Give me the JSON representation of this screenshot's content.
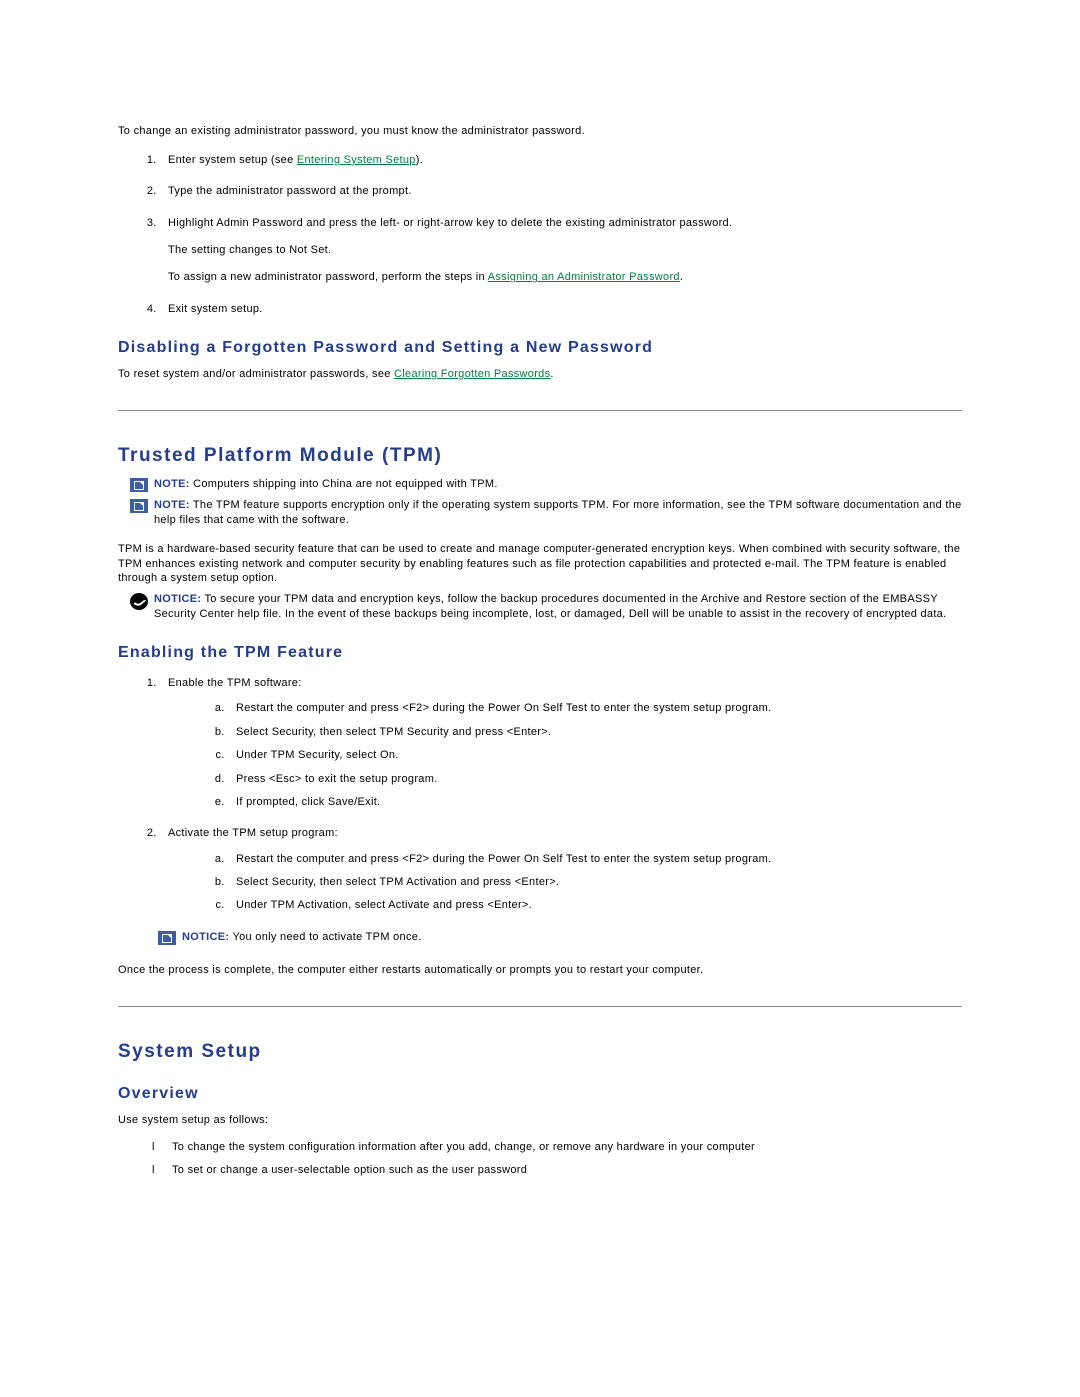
{
  "intro": "To change an existing administrator password, you must know the administrator password.",
  "adminSteps": {
    "s1a": "Enter system setup (see ",
    "s1link": "Entering System Setup",
    "s1b": ").",
    "s2": "Type the administrator password at the prompt.",
    "s3a": "Highlight Admin Password and press the left- or right-arrow key to delete the existing administrator password.",
    "s3b": "The setting changes to Not Set.",
    "s3c": "To assign a new administrator password, perform the steps in ",
    "s3link": "Assigning an Administrator Password",
    "s3d": ".",
    "s4": "Exit system setup."
  },
  "disable": {
    "heading": "Disabling a Forgotten Password and Setting a New Password",
    "textA": "To reset system and/or administrator passwords, see ",
    "link": "Clearing Forgotten Passwords",
    "textB": "."
  },
  "tpm": {
    "heading": "Trusted Platform Module (TPM)",
    "note1": " Computers shipping into China are not equipped with TPM.",
    "note2": " The TPM feature supports encryption only if the operating system supports TPM. For more information, see the TPM software documentation and the help files that came with the software.",
    "desc": "TPM is a hardware-based security feature that can be used to create and manage computer-generated encryption keys. When combined with security software, the TPM enhances existing network and computer security by enabling features such as file protection capabilities and protected e-mail. The TPM feature is enabled through a system setup option.",
    "notice": " To secure your TPM data and encryption keys, follow the backup procedures documented in the Archive and Restore section of the EMBASSY Security Center help file. In the event of these backups being incomplete, lost, or damaged, Dell will be unable to assist in the recovery of encrypted data.",
    "enableHeading": "Enabling the TPM Feature",
    "ol1": {
      "main": "Enable the TPM software:",
      "a": "Restart the computer and press <F2> during the Power On Self Test to enter the system setup program.",
      "b": "Select Security, then select TPM Security and press <Enter>.",
      "c": "Under TPM Security, select On.",
      "d": "Press <Esc> to exit the setup program.",
      "e": "If prompted, click Save/Exit."
    },
    "ol2": {
      "main": "Activate the TPM setup program:",
      "a": "Restart the computer and press <F2> during the Power On Self Test to enter the system setup program.",
      "b": "Select Security, then select TPM Activation and press <Enter>.",
      "c": "Under TPM Activation, select Activate and press <Enter>."
    },
    "notice2": " You only need to activate TPM once.",
    "after": "Once the process is complete, the computer either restarts automatically or prompts you to restart your computer."
  },
  "labels": {
    "note": "NOTE:",
    "notice": "NOTICE:"
  },
  "setup": {
    "heading": "System Setup",
    "overview": "Overview",
    "intro": "Use system setup as follows:",
    "b1": "To change the system configuration information after you add, change, or remove any hardware in your computer",
    "b2": "To set or change a user-selectable option such as the user password"
  }
}
